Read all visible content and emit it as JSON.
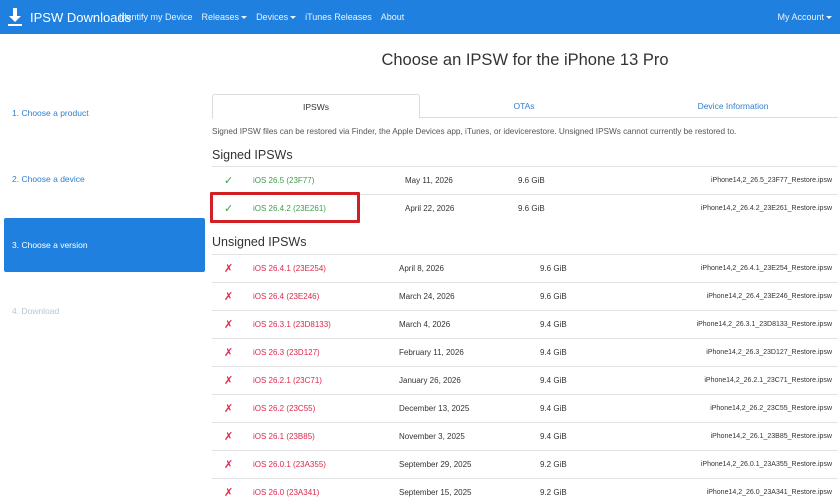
{
  "navbar": {
    "brand": "IPSW Downloads",
    "links": [
      "Identify my Device",
      "Releases",
      "Devices",
      "iTunes Releases",
      "About"
    ],
    "account": "My Account"
  },
  "sidebar": {
    "steps": [
      {
        "label": "1. Choose a product"
      },
      {
        "label": "2. Choose a device"
      },
      {
        "label": "3. Choose a version"
      },
      {
        "label": "4. Download"
      }
    ]
  },
  "main": {
    "title": "Choose an IPSW for the iPhone 13 Pro",
    "tabs": [
      "IPSWs",
      "OTAs",
      "Device Information"
    ],
    "info": "Signed IPSW files can be restored via Finder, the Apple Devices app, iTunes, or idevicerestore. Unsigned IPSWs cannot currently be restored to.",
    "signed_heading": "Signed IPSWs",
    "unsigned_heading": "Unsigned IPSWs",
    "signed": [
      {
        "mark": "✓",
        "version": "iOS 26.5 (23F77)",
        "date": "May 11, 2026",
        "size": "9.6 GiB",
        "file": "iPhone14,2_26.5_23F77_Restore.ipsw"
      },
      {
        "mark": "✓",
        "version": "iOS 26.4.2 (23E261)",
        "date": "April 22, 2026",
        "size": "9.6 GiB",
        "file": "iPhone14,2_26.4.2_23E261_Restore.ipsw"
      }
    ],
    "unsigned": [
      {
        "mark": "✗",
        "version": "iOS 26.4.1 (23E254)",
        "date": "April 8, 2026",
        "size": "9.6 GiB",
        "file": "iPhone14,2_26.4.1_23E254_Restore.ipsw"
      },
      {
        "mark": "✗",
        "version": "iOS 26.4 (23E246)",
        "date": "March 24, 2026",
        "size": "9.6 GiB",
        "file": "iPhone14,2_26.4_23E246_Restore.ipsw"
      },
      {
        "mark": "✗",
        "version": "iOS 26.3.1 (23D8133)",
        "date": "March 4, 2026",
        "size": "9.4 GiB",
        "file": "iPhone14,2_26.3.1_23D8133_Restore.ipsw"
      },
      {
        "mark": "✗",
        "version": "iOS 26.3 (23D127)",
        "date": "February 11, 2026",
        "size": "9.4 GiB",
        "file": "iPhone14,2_26.3_23D127_Restore.ipsw"
      },
      {
        "mark": "✗",
        "version": "iOS 26.2.1 (23C71)",
        "date": "January 26, 2026",
        "size": "9.4 GiB",
        "file": "iPhone14,2_26.2.1_23C71_Restore.ipsw"
      },
      {
        "mark": "✗",
        "version": "iOS 26.2 (23C55)",
        "date": "December 13, 2025",
        "size": "9.4 GiB",
        "file": "iPhone14,2_26.2_23C55_Restore.ipsw"
      },
      {
        "mark": "✗",
        "version": "iOS 26.1 (23B85)",
        "date": "November 3, 2025",
        "size": "9.4 GiB",
        "file": "iPhone14,2_26.1_23B85_Restore.ipsw"
      },
      {
        "mark": "✗",
        "version": "iOS 26.0.1 (23A355)",
        "date": "September 29, 2025",
        "size": "9.2 GiB",
        "file": "iPhone14,2_26.0.1_23A355_Restore.ipsw"
      },
      {
        "mark": "✗",
        "version": "iOS 26.0 (23A341)",
        "date": "September 15, 2025",
        "size": "9.2 GiB",
        "file": "iPhone14,2_26.0_23A341_Restore.ipsw"
      }
    ]
  },
  "colors": {
    "accent": "#1f80e0",
    "signed": "#3aa14a",
    "unsigned": "#e0274b",
    "highlight": "#d21f24"
  },
  "icons": {
    "brand": "download-icon",
    "signed": "check-icon",
    "unsigned": "cross-icon"
  }
}
